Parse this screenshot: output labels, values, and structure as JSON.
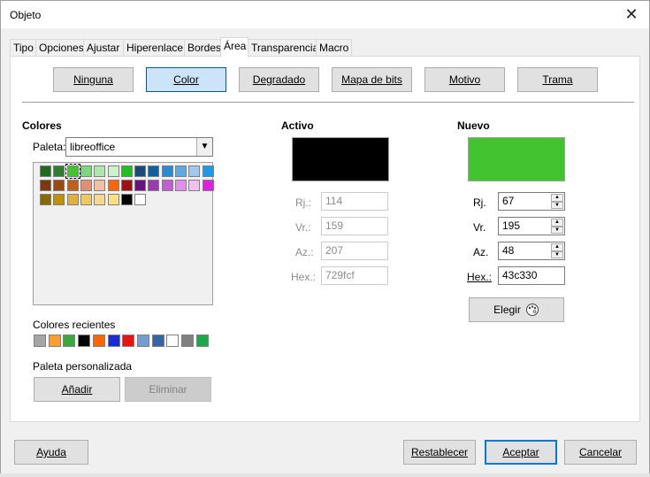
{
  "window": {
    "title": "Objeto",
    "close_glyph": "✕"
  },
  "tabs": [
    {
      "label": "Tipo"
    },
    {
      "label": "Opciones"
    },
    {
      "label": "Ajustar"
    },
    {
      "label": "Hiperenlace"
    },
    {
      "label": "Bordes"
    },
    {
      "label": "Área"
    },
    {
      "label": "Transparencia"
    },
    {
      "label": "Macro"
    }
  ],
  "fill_types": {
    "none": "Ninguna",
    "color": "Color",
    "gradient": "Degradado",
    "bitmap": "Mapa de bits",
    "pattern": "Motivo",
    "hatch": "Trama",
    "selected": "Color"
  },
  "colors": {
    "heading": "Colores",
    "palette_label": "Paleta:",
    "palette_value": "libreoffice",
    "palette_swatches": [
      "#1e6a1e",
      "#2e7d32",
      "#43c330",
      "#7ed67e",
      "#aee6ae",
      "#ccf2cc",
      "#20c020",
      "#1a4a7a",
      "#1060a0",
      "#2a8ad4",
      "#60a8e0",
      "#a0c8f0",
      "#1c9ae8",
      "#7a3a10",
      "#9a4a10",
      "#c0601a",
      "#e09070",
      "#f0c0a0",
      "#ff6600",
      "#a01010",
      "#6a1080",
      "#9a3ab0",
      "#c060d0",
      "#e090e8",
      "#f0c0f0",
      "#e020e0",
      "#8a6a00",
      "#c09000",
      "#e0b040",
      "#f0c860",
      "#f8d890",
      "#ffe080",
      "#000000",
      "#ffffff"
    ],
    "recent_label": "Colores recientes",
    "recent_swatches": [
      "#a6a6a6",
      "#ff9f2f",
      "#3aa83a",
      "#000000",
      "#ff6600",
      "#1a2ad8",
      "#ee1111",
      "#729fcf",
      "#3465a4",
      "#ffffff",
      "#808080",
      "#1aa84a"
    ],
    "custom_label": "Paleta personalizada",
    "add_button": "Añadir",
    "delete_button": "Eliminar"
  },
  "active": {
    "heading": "Activo",
    "preview_color": "#000000",
    "r_label": "Rj.:",
    "r_value": "114",
    "g_label": "Vr.:",
    "g_value": "159",
    "b_label": "Az.:",
    "b_value": "207",
    "hex_label": "Hex.:",
    "hex_value": "729fcf"
  },
  "new": {
    "heading": "Nuevo",
    "preview_color": "#43c330",
    "r_label": "Rj.",
    "r_value": "67",
    "g_label": "Vr.",
    "g_value": "195",
    "b_label": "Az.",
    "b_value": "48",
    "hex_label": "Hex.:",
    "hex_value": "43c330",
    "pick_button": "Elegir"
  },
  "footer": {
    "help": "Ayuda",
    "reset": "Restablecer",
    "ok": "Aceptar",
    "cancel": "Cancelar"
  }
}
